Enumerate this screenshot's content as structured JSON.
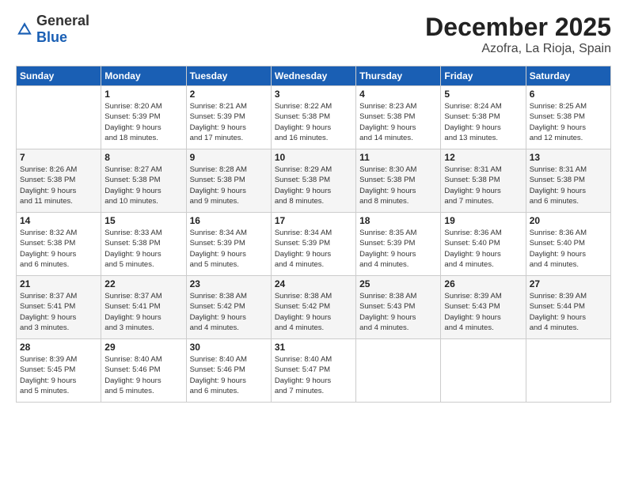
{
  "header": {
    "logo_general": "General",
    "logo_blue": "Blue",
    "title": "December 2025",
    "location": "Azofra, La Rioja, Spain"
  },
  "days_of_week": [
    "Sunday",
    "Monday",
    "Tuesday",
    "Wednesday",
    "Thursday",
    "Friday",
    "Saturday"
  ],
  "weeks": [
    [
      {
        "day": "",
        "info": ""
      },
      {
        "day": "1",
        "info": "Sunrise: 8:20 AM\nSunset: 5:39 PM\nDaylight: 9 hours\nand 18 minutes."
      },
      {
        "day": "2",
        "info": "Sunrise: 8:21 AM\nSunset: 5:39 PM\nDaylight: 9 hours\nand 17 minutes."
      },
      {
        "day": "3",
        "info": "Sunrise: 8:22 AM\nSunset: 5:38 PM\nDaylight: 9 hours\nand 16 minutes."
      },
      {
        "day": "4",
        "info": "Sunrise: 8:23 AM\nSunset: 5:38 PM\nDaylight: 9 hours\nand 14 minutes."
      },
      {
        "day": "5",
        "info": "Sunrise: 8:24 AM\nSunset: 5:38 PM\nDaylight: 9 hours\nand 13 minutes."
      },
      {
        "day": "6",
        "info": "Sunrise: 8:25 AM\nSunset: 5:38 PM\nDaylight: 9 hours\nand 12 minutes."
      }
    ],
    [
      {
        "day": "7",
        "info": "Sunrise: 8:26 AM\nSunset: 5:38 PM\nDaylight: 9 hours\nand 11 minutes."
      },
      {
        "day": "8",
        "info": "Sunrise: 8:27 AM\nSunset: 5:38 PM\nDaylight: 9 hours\nand 10 minutes."
      },
      {
        "day": "9",
        "info": "Sunrise: 8:28 AM\nSunset: 5:38 PM\nDaylight: 9 hours\nand 9 minutes."
      },
      {
        "day": "10",
        "info": "Sunrise: 8:29 AM\nSunset: 5:38 PM\nDaylight: 9 hours\nand 8 minutes."
      },
      {
        "day": "11",
        "info": "Sunrise: 8:30 AM\nSunset: 5:38 PM\nDaylight: 9 hours\nand 8 minutes."
      },
      {
        "day": "12",
        "info": "Sunrise: 8:31 AM\nSunset: 5:38 PM\nDaylight: 9 hours\nand 7 minutes."
      },
      {
        "day": "13",
        "info": "Sunrise: 8:31 AM\nSunset: 5:38 PM\nDaylight: 9 hours\nand 6 minutes."
      }
    ],
    [
      {
        "day": "14",
        "info": "Sunrise: 8:32 AM\nSunset: 5:38 PM\nDaylight: 9 hours\nand 6 minutes."
      },
      {
        "day": "15",
        "info": "Sunrise: 8:33 AM\nSunset: 5:38 PM\nDaylight: 9 hours\nand 5 minutes."
      },
      {
        "day": "16",
        "info": "Sunrise: 8:34 AM\nSunset: 5:39 PM\nDaylight: 9 hours\nand 5 minutes."
      },
      {
        "day": "17",
        "info": "Sunrise: 8:34 AM\nSunset: 5:39 PM\nDaylight: 9 hours\nand 4 minutes."
      },
      {
        "day": "18",
        "info": "Sunrise: 8:35 AM\nSunset: 5:39 PM\nDaylight: 9 hours\nand 4 minutes."
      },
      {
        "day": "19",
        "info": "Sunrise: 8:36 AM\nSunset: 5:40 PM\nDaylight: 9 hours\nand 4 minutes."
      },
      {
        "day": "20",
        "info": "Sunrise: 8:36 AM\nSunset: 5:40 PM\nDaylight: 9 hours\nand 4 minutes."
      }
    ],
    [
      {
        "day": "21",
        "info": "Sunrise: 8:37 AM\nSunset: 5:41 PM\nDaylight: 9 hours\nand 3 minutes."
      },
      {
        "day": "22",
        "info": "Sunrise: 8:37 AM\nSunset: 5:41 PM\nDaylight: 9 hours\nand 3 minutes."
      },
      {
        "day": "23",
        "info": "Sunrise: 8:38 AM\nSunset: 5:42 PM\nDaylight: 9 hours\nand 4 minutes."
      },
      {
        "day": "24",
        "info": "Sunrise: 8:38 AM\nSunset: 5:42 PM\nDaylight: 9 hours\nand 4 minutes."
      },
      {
        "day": "25",
        "info": "Sunrise: 8:38 AM\nSunset: 5:43 PM\nDaylight: 9 hours\nand 4 minutes."
      },
      {
        "day": "26",
        "info": "Sunrise: 8:39 AM\nSunset: 5:43 PM\nDaylight: 9 hours\nand 4 minutes."
      },
      {
        "day": "27",
        "info": "Sunrise: 8:39 AM\nSunset: 5:44 PM\nDaylight: 9 hours\nand 4 minutes."
      }
    ],
    [
      {
        "day": "28",
        "info": "Sunrise: 8:39 AM\nSunset: 5:45 PM\nDaylight: 9 hours\nand 5 minutes."
      },
      {
        "day": "29",
        "info": "Sunrise: 8:40 AM\nSunset: 5:46 PM\nDaylight: 9 hours\nand 5 minutes."
      },
      {
        "day": "30",
        "info": "Sunrise: 8:40 AM\nSunset: 5:46 PM\nDaylight: 9 hours\nand 6 minutes."
      },
      {
        "day": "31",
        "info": "Sunrise: 8:40 AM\nSunset: 5:47 PM\nDaylight: 9 hours\nand 7 minutes."
      },
      {
        "day": "",
        "info": ""
      },
      {
        "day": "",
        "info": ""
      },
      {
        "day": "",
        "info": ""
      }
    ]
  ]
}
